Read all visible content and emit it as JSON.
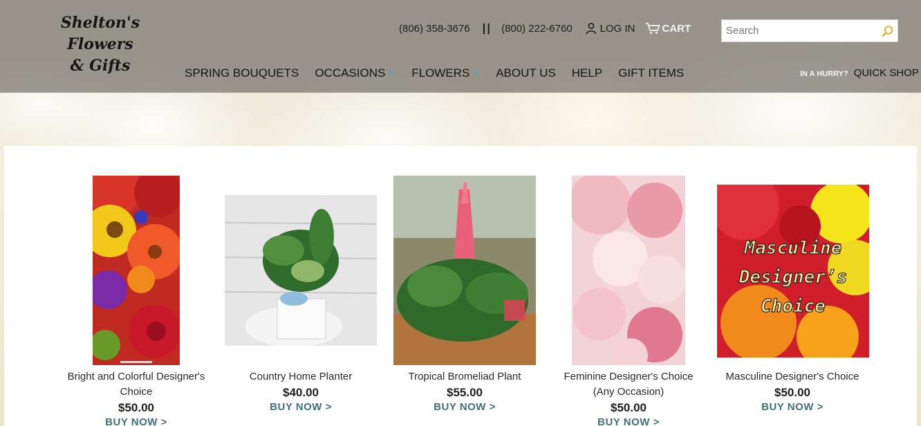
{
  "brand": {
    "logo_line1": "Shelton's Flowers",
    "logo_line2": "& Gifts"
  },
  "topbar": {
    "phone_local": "(806) 358-3676",
    "separator": "||",
    "phone_tollfree": "(800) 222-6760",
    "login_label": "LOG IN",
    "cart_label": "CART"
  },
  "search": {
    "placeholder": "Search"
  },
  "nav": {
    "items": [
      {
        "label": "SPRING BOUQUETS"
      },
      {
        "label": "OCCASIONS",
        "has_dropdown": true
      },
      {
        "label": "FLOWERS",
        "has_dropdown": true
      },
      {
        "label": "ABOUT US"
      },
      {
        "label": "HELP"
      },
      {
        "label": "GIFT ITEMS"
      }
    ]
  },
  "quickshop": {
    "hurry_label": "IN A HURRY?",
    "label": "QUICK SHOP"
  },
  "products": [
    {
      "name": "Bright and Colorful Designer's Choice",
      "price": "$50.00",
      "cta": "BUY NOW >"
    },
    {
      "name": "Country Home Planter",
      "price": "$40.00",
      "cta": "BUY NOW >"
    },
    {
      "name": "Tropical Bromeliad Plant",
      "price": "$55.00",
      "cta": "BUY NOW >"
    },
    {
      "name": "Feminine Designer's Choice (Any Occasion)",
      "price": "$50.00",
      "cta": "BUY NOW >"
    },
    {
      "name": "Masculine Designer's Choice",
      "price": "$50.00",
      "cta": "BUY NOW >",
      "image_text": "Masculine Designer's Choice"
    }
  ],
  "colors": {
    "header_overlay": "#807c74",
    "link": "#3f6e7a",
    "accent_caret": "#5aa3b8",
    "search_icon": "#e3b418"
  }
}
